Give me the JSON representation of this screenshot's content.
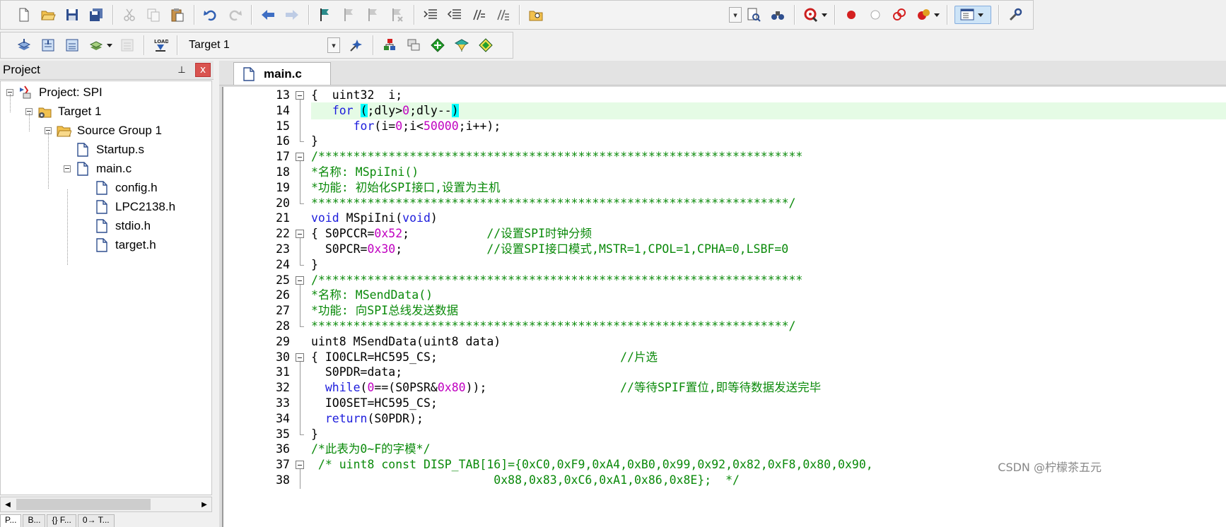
{
  "toolbar1": {
    "buttons": [
      "new-file",
      "open-file",
      "save",
      "save-all",
      "cut",
      "copy",
      "paste",
      "undo",
      "redo",
      "navigate-back",
      "navigate-forward",
      "bookmark-toggle",
      "bookmark-prev",
      "bookmark-next",
      "bookmark-clear",
      "indent",
      "unindent",
      "comment",
      "uncomment",
      "find-in-files",
      "find",
      "debug-zoom",
      "breakpoint-insert",
      "breakpoint-enable",
      "breakpoint-disable",
      "breakpoint-kill",
      "window-layout",
      "configure"
    ]
  },
  "toolbar2": {
    "target_label": "Target 1"
  },
  "project_panel": {
    "title": "Project",
    "pin_glyph": "⊥",
    "close_glyph": "x",
    "tree": [
      {
        "label": "Project: SPI",
        "level": 0,
        "icon": "project-icon",
        "expander": true
      },
      {
        "label": "Target 1",
        "level": 1,
        "icon": "target-folder-icon",
        "expander": true
      },
      {
        "label": "Source Group 1",
        "level": 2,
        "icon": "folder-icon",
        "expander": true
      },
      {
        "label": "Startup.s",
        "level": 3,
        "icon": "file-icon",
        "expander": false
      },
      {
        "label": "main.c",
        "level": 3,
        "icon": "file-icon",
        "expander": true
      },
      {
        "label": "config.h",
        "level": 4,
        "icon": "file-icon",
        "expander": false
      },
      {
        "label": "LPC2138.h",
        "level": 4,
        "icon": "file-icon",
        "expander": false
      },
      {
        "label": "stdio.h",
        "level": 4,
        "icon": "file-icon",
        "expander": false
      },
      {
        "label": "target.h",
        "level": 4,
        "icon": "file-icon",
        "expander": false
      }
    ],
    "bottom_tabs": [
      "P...",
      "B...",
      "{} F...",
      "0→ T..."
    ]
  },
  "editor": {
    "active_tab": "main.c",
    "highlight_color": "#e5fbe5",
    "lines": [
      {
        "n": "13",
        "fold": "box",
        "segs": [
          [
            "plain",
            "{  uint32  i;"
          ]
        ]
      },
      {
        "n": "14",
        "fold": "line",
        "hl": true,
        "segs": [
          [
            "plain",
            "   "
          ],
          [
            "kw",
            "for"
          ],
          [
            "plain",
            " "
          ],
          [
            "brk",
            "("
          ],
          [
            "plain",
            ";dly>"
          ],
          [
            "num",
            "0"
          ],
          [
            "plain",
            ";dly--"
          ],
          [
            "brk",
            ")"
          ]
        ]
      },
      {
        "n": "15",
        "fold": "line",
        "segs": [
          [
            "plain",
            "      "
          ],
          [
            "kw",
            "for"
          ],
          [
            "plain",
            "(i="
          ],
          [
            "num",
            "0"
          ],
          [
            "plain",
            ";i<"
          ],
          [
            "num",
            "50000"
          ],
          [
            "plain",
            ";i++);"
          ]
        ]
      },
      {
        "n": "16",
        "fold": "end",
        "segs": [
          [
            "plain",
            "}"
          ]
        ]
      },
      {
        "n": "17",
        "fold": "box",
        "segs": [
          [
            "cm",
            "/*********************************************************************"
          ]
        ]
      },
      {
        "n": "18",
        "fold": "line",
        "segs": [
          [
            "cm",
            "*名称: MSpiIni()"
          ]
        ]
      },
      {
        "n": "19",
        "fold": "line",
        "segs": [
          [
            "cm",
            "*功能: 初始化SPI接口,设置为主机"
          ]
        ]
      },
      {
        "n": "20",
        "fold": "end",
        "segs": [
          [
            "cm",
            "********************************************************************/"
          ]
        ]
      },
      {
        "n": "21",
        "fold": "none",
        "segs": [
          [
            "kw",
            "void"
          ],
          [
            "plain",
            " MSpiIni("
          ],
          [
            "kw",
            "void"
          ],
          [
            "plain",
            ")"
          ]
        ]
      },
      {
        "n": "22",
        "fold": "box",
        "segs": [
          [
            "plain",
            "{ S0PCCR="
          ],
          [
            "num",
            "0x52"
          ],
          [
            "plain",
            ";           "
          ],
          [
            "cm",
            "//设置SPI时钟分频"
          ]
        ]
      },
      {
        "n": "23",
        "fold": "line",
        "segs": [
          [
            "plain",
            "  S0PCR="
          ],
          [
            "num",
            "0x30"
          ],
          [
            "plain",
            ";            "
          ],
          [
            "cm",
            "//设置SPI接口模式,MSTR=1,CPOL=1,CPHA=0,LSBF=0"
          ]
        ]
      },
      {
        "n": "24",
        "fold": "end",
        "segs": [
          [
            "plain",
            "}"
          ]
        ]
      },
      {
        "n": "25",
        "fold": "box",
        "segs": [
          [
            "cm",
            "/*********************************************************************"
          ]
        ]
      },
      {
        "n": "26",
        "fold": "line",
        "segs": [
          [
            "cm",
            "*名称: MSendData()"
          ]
        ]
      },
      {
        "n": "27",
        "fold": "line",
        "segs": [
          [
            "cm",
            "*功能: 向SPI总线发送数据"
          ]
        ]
      },
      {
        "n": "28",
        "fold": "end",
        "segs": [
          [
            "cm",
            "********************************************************************/"
          ]
        ]
      },
      {
        "n": "29",
        "fold": "none",
        "segs": [
          [
            "plain",
            "uint8 MSendData(uint8 data)"
          ]
        ]
      },
      {
        "n": "30",
        "fold": "box",
        "segs": [
          [
            "plain",
            "{ IO0CLR=HC595_CS;                          "
          ],
          [
            "cm",
            "//片选"
          ]
        ]
      },
      {
        "n": "31",
        "fold": "line",
        "segs": [
          [
            "plain",
            "  S0PDR=data;"
          ]
        ]
      },
      {
        "n": "32",
        "fold": "line",
        "segs": [
          [
            "plain",
            "  "
          ],
          [
            "kw",
            "while"
          ],
          [
            "plain",
            "("
          ],
          [
            "num",
            "0"
          ],
          [
            "plain",
            "==(S0PSR&"
          ],
          [
            "num",
            "0x80"
          ],
          [
            "plain",
            "));                   "
          ],
          [
            "cm",
            "//等待SPIF置位,即等待数据发送完毕"
          ]
        ]
      },
      {
        "n": "33",
        "fold": "line",
        "segs": [
          [
            "plain",
            "  IO0SET=HC595_CS;"
          ]
        ]
      },
      {
        "n": "34",
        "fold": "line",
        "segs": [
          [
            "plain",
            "  "
          ],
          [
            "kw",
            "return"
          ],
          [
            "plain",
            "(S0PDR);"
          ]
        ]
      },
      {
        "n": "35",
        "fold": "end",
        "segs": [
          [
            "plain",
            "}"
          ]
        ]
      },
      {
        "n": "36",
        "fold": "none",
        "segs": [
          [
            "cm",
            "/*此表为0~F的字模*/"
          ]
        ]
      },
      {
        "n": "37",
        "fold": "box",
        "segs": [
          [
            "cm",
            " /* uint8 const DISP_TAB[16]={0xC0,0xF9,0xA4,0xB0,0x99,0x92,0x82,0xF8,0x80,0x90,"
          ]
        ]
      },
      {
        "n": "38",
        "fold": "line",
        "segs": [
          [
            "cm",
            "                          0x88,0x83,0xC6,0xA1,0x86,0x8E};  */"
          ]
        ]
      }
    ]
  },
  "watermark": "CSDN @柠檬茶五元"
}
